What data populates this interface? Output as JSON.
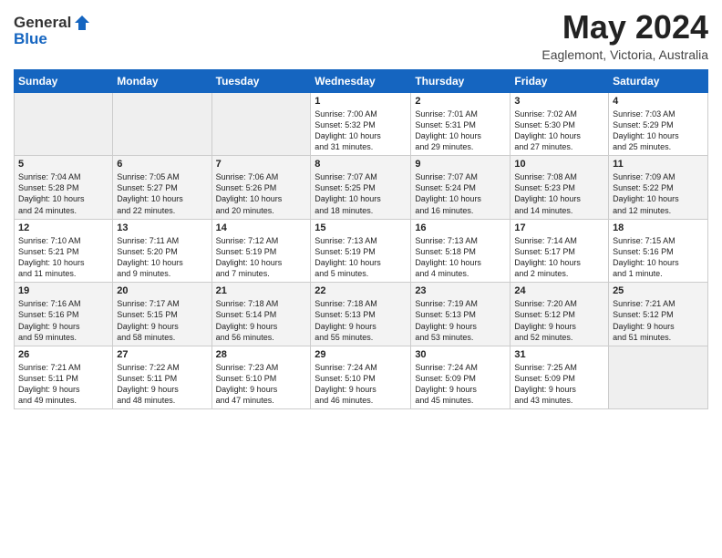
{
  "header": {
    "logo_line1": "General",
    "logo_line2": "Blue",
    "month_year": "May 2024",
    "location": "Eaglemont, Victoria, Australia"
  },
  "weekdays": [
    "Sunday",
    "Monday",
    "Tuesday",
    "Wednesday",
    "Thursday",
    "Friday",
    "Saturday"
  ],
  "weeks": [
    [
      {
        "day": "",
        "info": ""
      },
      {
        "day": "",
        "info": ""
      },
      {
        "day": "",
        "info": ""
      },
      {
        "day": "1",
        "info": "Sunrise: 7:00 AM\nSunset: 5:32 PM\nDaylight: 10 hours\nand 31 minutes."
      },
      {
        "day": "2",
        "info": "Sunrise: 7:01 AM\nSunset: 5:31 PM\nDaylight: 10 hours\nand 29 minutes."
      },
      {
        "day": "3",
        "info": "Sunrise: 7:02 AM\nSunset: 5:30 PM\nDaylight: 10 hours\nand 27 minutes."
      },
      {
        "day": "4",
        "info": "Sunrise: 7:03 AM\nSunset: 5:29 PM\nDaylight: 10 hours\nand 25 minutes."
      }
    ],
    [
      {
        "day": "5",
        "info": "Sunrise: 7:04 AM\nSunset: 5:28 PM\nDaylight: 10 hours\nand 24 minutes."
      },
      {
        "day": "6",
        "info": "Sunrise: 7:05 AM\nSunset: 5:27 PM\nDaylight: 10 hours\nand 22 minutes."
      },
      {
        "day": "7",
        "info": "Sunrise: 7:06 AM\nSunset: 5:26 PM\nDaylight: 10 hours\nand 20 minutes."
      },
      {
        "day": "8",
        "info": "Sunrise: 7:07 AM\nSunset: 5:25 PM\nDaylight: 10 hours\nand 18 minutes."
      },
      {
        "day": "9",
        "info": "Sunrise: 7:07 AM\nSunset: 5:24 PM\nDaylight: 10 hours\nand 16 minutes."
      },
      {
        "day": "10",
        "info": "Sunrise: 7:08 AM\nSunset: 5:23 PM\nDaylight: 10 hours\nand 14 minutes."
      },
      {
        "day": "11",
        "info": "Sunrise: 7:09 AM\nSunset: 5:22 PM\nDaylight: 10 hours\nand 12 minutes."
      }
    ],
    [
      {
        "day": "12",
        "info": "Sunrise: 7:10 AM\nSunset: 5:21 PM\nDaylight: 10 hours\nand 11 minutes."
      },
      {
        "day": "13",
        "info": "Sunrise: 7:11 AM\nSunset: 5:20 PM\nDaylight: 10 hours\nand 9 minutes."
      },
      {
        "day": "14",
        "info": "Sunrise: 7:12 AM\nSunset: 5:19 PM\nDaylight: 10 hours\nand 7 minutes."
      },
      {
        "day": "15",
        "info": "Sunrise: 7:13 AM\nSunset: 5:19 PM\nDaylight: 10 hours\nand 5 minutes."
      },
      {
        "day": "16",
        "info": "Sunrise: 7:13 AM\nSunset: 5:18 PM\nDaylight: 10 hours\nand 4 minutes."
      },
      {
        "day": "17",
        "info": "Sunrise: 7:14 AM\nSunset: 5:17 PM\nDaylight: 10 hours\nand 2 minutes."
      },
      {
        "day": "18",
        "info": "Sunrise: 7:15 AM\nSunset: 5:16 PM\nDaylight: 10 hours\nand 1 minute."
      }
    ],
    [
      {
        "day": "19",
        "info": "Sunrise: 7:16 AM\nSunset: 5:16 PM\nDaylight: 9 hours\nand 59 minutes."
      },
      {
        "day": "20",
        "info": "Sunrise: 7:17 AM\nSunset: 5:15 PM\nDaylight: 9 hours\nand 58 minutes."
      },
      {
        "day": "21",
        "info": "Sunrise: 7:18 AM\nSunset: 5:14 PM\nDaylight: 9 hours\nand 56 minutes."
      },
      {
        "day": "22",
        "info": "Sunrise: 7:18 AM\nSunset: 5:13 PM\nDaylight: 9 hours\nand 55 minutes."
      },
      {
        "day": "23",
        "info": "Sunrise: 7:19 AM\nSunset: 5:13 PM\nDaylight: 9 hours\nand 53 minutes."
      },
      {
        "day": "24",
        "info": "Sunrise: 7:20 AM\nSunset: 5:12 PM\nDaylight: 9 hours\nand 52 minutes."
      },
      {
        "day": "25",
        "info": "Sunrise: 7:21 AM\nSunset: 5:12 PM\nDaylight: 9 hours\nand 51 minutes."
      }
    ],
    [
      {
        "day": "26",
        "info": "Sunrise: 7:21 AM\nSunset: 5:11 PM\nDaylight: 9 hours\nand 49 minutes."
      },
      {
        "day": "27",
        "info": "Sunrise: 7:22 AM\nSunset: 5:11 PM\nDaylight: 9 hours\nand 48 minutes."
      },
      {
        "day": "28",
        "info": "Sunrise: 7:23 AM\nSunset: 5:10 PM\nDaylight: 9 hours\nand 47 minutes."
      },
      {
        "day": "29",
        "info": "Sunrise: 7:24 AM\nSunset: 5:10 PM\nDaylight: 9 hours\nand 46 minutes."
      },
      {
        "day": "30",
        "info": "Sunrise: 7:24 AM\nSunset: 5:09 PM\nDaylight: 9 hours\nand 45 minutes."
      },
      {
        "day": "31",
        "info": "Sunrise: 7:25 AM\nSunset: 5:09 PM\nDaylight: 9 hours\nand 43 minutes."
      },
      {
        "day": "",
        "info": ""
      }
    ]
  ],
  "colors": {
    "header_bg": "#1565c0",
    "header_text": "#ffffff",
    "row_odd": "#f5f5f5",
    "row_even": "#ffffff"
  }
}
